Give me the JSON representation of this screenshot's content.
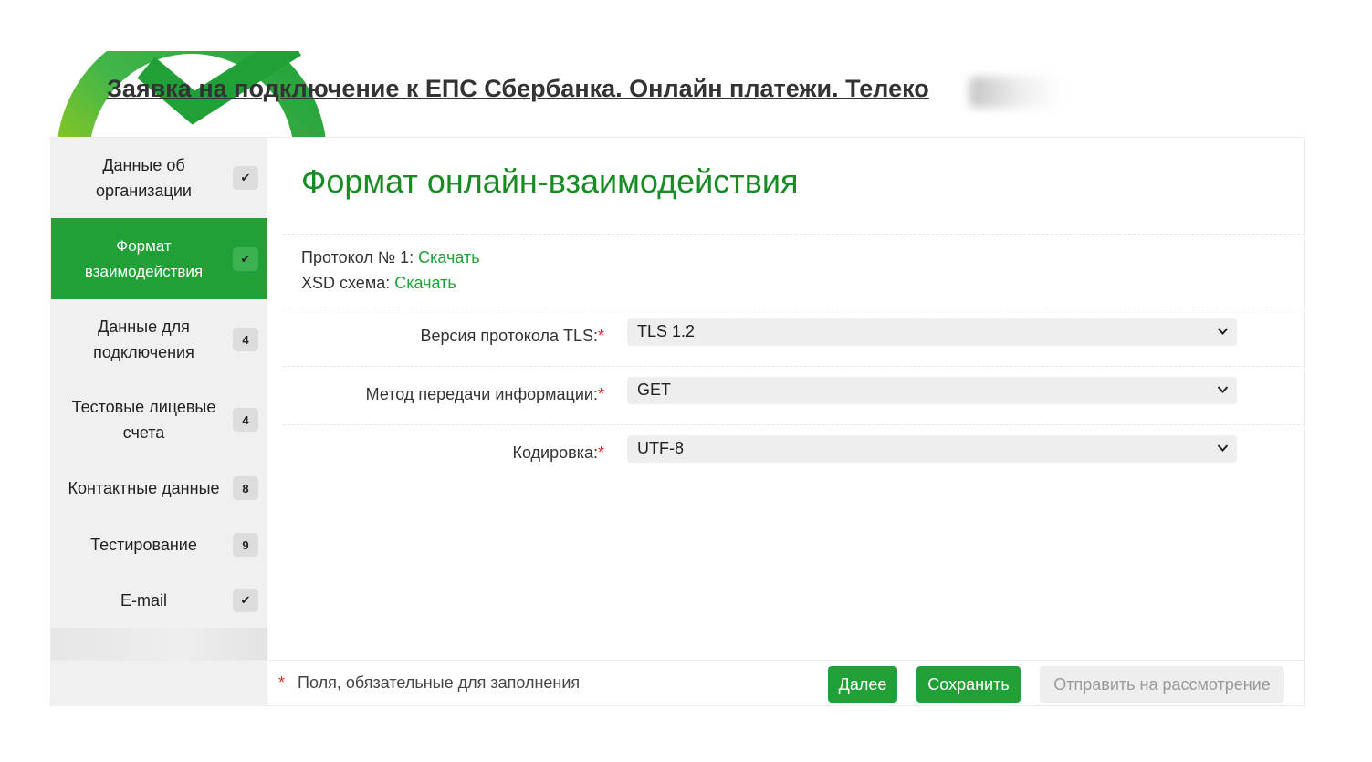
{
  "header": {
    "title": "Заявка на подключение к ЕПС Сбербанка. Онлайн платежи. Телеко"
  },
  "colors": {
    "brand_green": "#21a038",
    "title_green": "#178c22",
    "required_red": "#e3282b"
  },
  "sidebar": {
    "items": [
      {
        "label": "Данные об организации",
        "badge": "✔",
        "active": false
      },
      {
        "label": "Формат взаимодействия",
        "badge": "✔",
        "active": true
      },
      {
        "label": "Данные для подключения",
        "badge": "4",
        "active": false
      },
      {
        "label": "Тестовые лицевые счета",
        "badge": "4",
        "active": false
      },
      {
        "label": "Контактные данные",
        "badge": "8",
        "active": false
      },
      {
        "label": "Тестирование",
        "badge": "9",
        "active": false
      },
      {
        "label": "E-mail",
        "badge": "✔",
        "active": false
      }
    ]
  },
  "main": {
    "section_title": "Формат онлайн-взаимодействия",
    "documents": [
      {
        "label": "Протокол № 1:",
        "link": "Скачать"
      },
      {
        "label": "XSD схема:",
        "link": "Скачать"
      }
    ],
    "fields": [
      {
        "label": "Версия протокола TLS:",
        "required_mark": "*",
        "value": "TLS 1.2"
      },
      {
        "label": "Метод передачи информации:",
        "required_mark": "*",
        "value": "GET"
      },
      {
        "label": "Кодировка:",
        "required_mark": "*",
        "value": "UTF-8"
      }
    ]
  },
  "footer": {
    "required_mark": "*",
    "required_note": "Поля, обязательные для заполнения",
    "next_label": "Далее",
    "save_label": "Сохранить",
    "submit_label": "Отправить на рассмотрение"
  }
}
